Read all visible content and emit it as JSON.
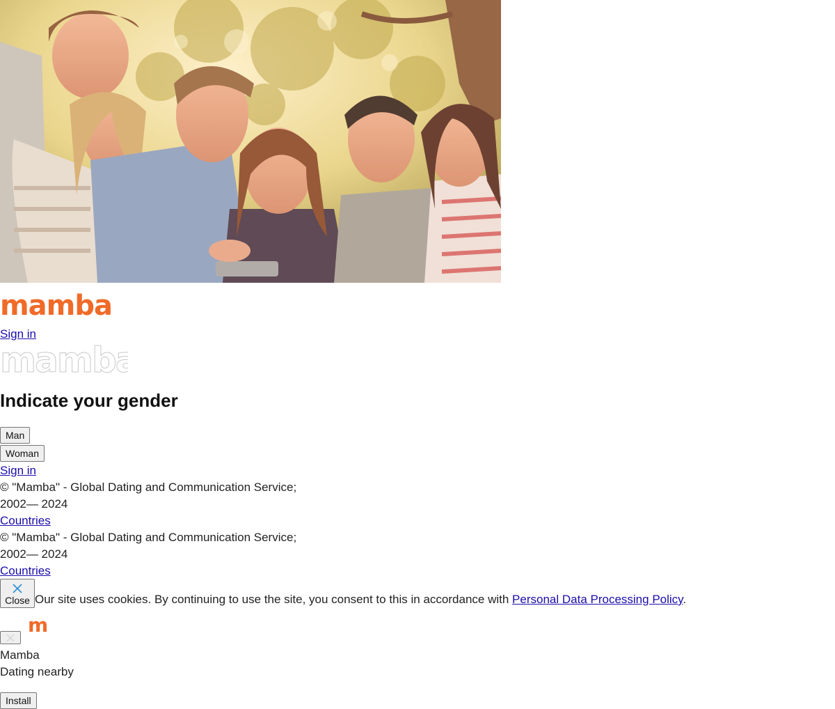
{
  "header": {
    "logo_text": "mamba",
    "sign_in": "Sign in",
    "watermark_logo_text": "mamba"
  },
  "hero": {
    "image_icon": "group-of-friends-photo"
  },
  "gender": {
    "title": "Indicate your gender",
    "options": [
      "Man",
      "Woman"
    ],
    "sign_in": "Sign in"
  },
  "footer": [
    {
      "copyright": "© \"Mamba\" - Global Dating and Communication Service;",
      "years": "2002— 2024",
      "countries": "Countries"
    },
    {
      "copyright": "© \"Mamba\" - Global Dating and Communication Service;",
      "years": "2002— 2024",
      "countries": "Countries"
    }
  ],
  "cookie": {
    "close_label": "Close",
    "text": "Our site uses cookies. By continuing to use the site, you consent to this in accordance with ",
    "policy_link": "Personal Data Processing Policy",
    "end": "."
  },
  "app_banner": {
    "app_icon_letter": "m",
    "name": "Mamba",
    "tagline": "Dating nearby",
    "install": "Install"
  },
  "colors": {
    "brand": "#f06a28",
    "link": "#1a0dab"
  }
}
